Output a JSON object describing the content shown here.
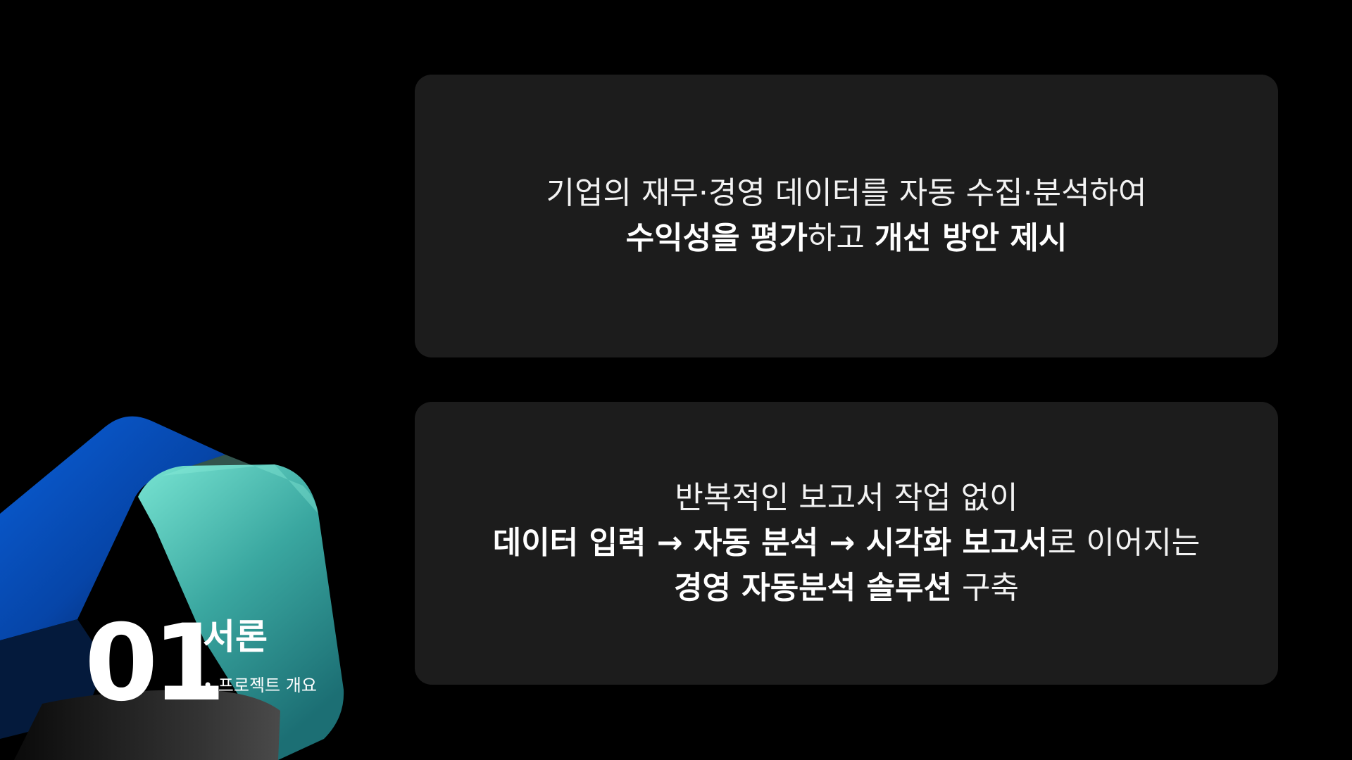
{
  "section": {
    "number": "01",
    "title": "서론",
    "subtitle": "• 프로젝트 개요"
  },
  "colors": {
    "background": "#000000",
    "card": "#1c1c1c",
    "shape_blue": "#0a5fd8",
    "shape_teal": "#6fe0cc",
    "text": "#ffffff"
  },
  "card1": {
    "line1": "기업의 재무·경영 데이터를 자동 수집·분석하여",
    "line2": {
      "part1": "수익성을 평가",
      "part2": "하고 ",
      "part3": "개선 방안 제시"
    }
  },
  "card2": {
    "line1": "반복적인 보고서 작업 없이",
    "line2": {
      "part1": "데이터 입력 → 자동 분석 → 시각화 보고서",
      "part2": "로 이어지는"
    },
    "line3": {
      "part1": "경영 자동분석 솔루션",
      "part2": " 구축"
    }
  }
}
